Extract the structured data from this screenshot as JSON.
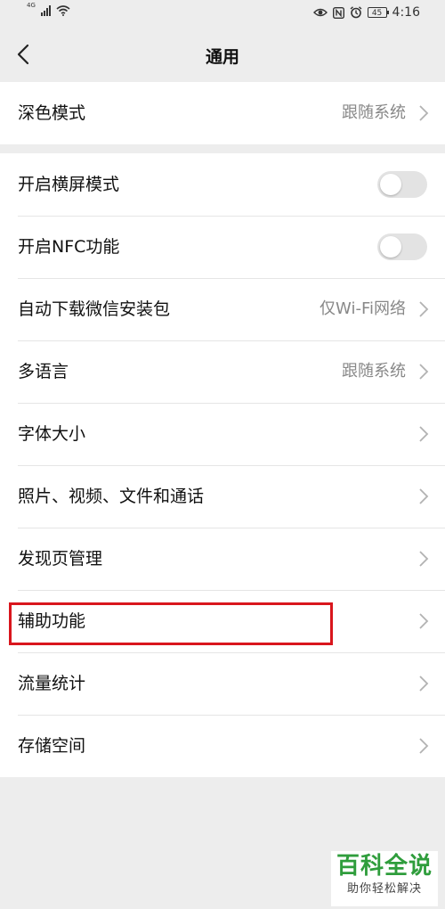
{
  "status_bar": {
    "network": "4G",
    "signal_icon": "signal-bars-icon",
    "wifi_icon": "wifi-icon",
    "eye_icon": "eye-comfort-icon",
    "nfc_icon": "nfc-icon",
    "alarm_icon": "alarm-clock-icon",
    "battery": "45",
    "time": "4:16"
  },
  "nav": {
    "title": "通用",
    "back_icon": "chevron-left-icon"
  },
  "groups": [
    {
      "rows": [
        {
          "label": "深色模式",
          "value": "跟随系统",
          "type": "link"
        }
      ]
    },
    {
      "rows": [
        {
          "label": "开启横屏模式",
          "type": "toggle",
          "on": false
        },
        {
          "label": "开启NFC功能",
          "type": "toggle",
          "on": false
        },
        {
          "label": "自动下载微信安装包",
          "value": "仅Wi-Fi网络",
          "type": "link"
        },
        {
          "label": "多语言",
          "value": "跟随系统",
          "type": "link"
        },
        {
          "label": "字体大小",
          "type": "link"
        },
        {
          "label": "照片、视频、文件和通话",
          "type": "link"
        },
        {
          "label": "发现页管理",
          "type": "link"
        },
        {
          "label": "辅助功能",
          "type": "link"
        },
        {
          "label": "流量统计",
          "type": "link"
        },
        {
          "label": "存储空间",
          "type": "link"
        }
      ]
    }
  ],
  "watermark": {
    "title": "百科全说",
    "subtitle": "助你轻松解决"
  },
  "colors": {
    "background": "#ededed",
    "card": "#ffffff",
    "highlight": "#d9161d",
    "watermark_green": "#2f9d3c",
    "toggle_off": "#e3e3e3"
  }
}
